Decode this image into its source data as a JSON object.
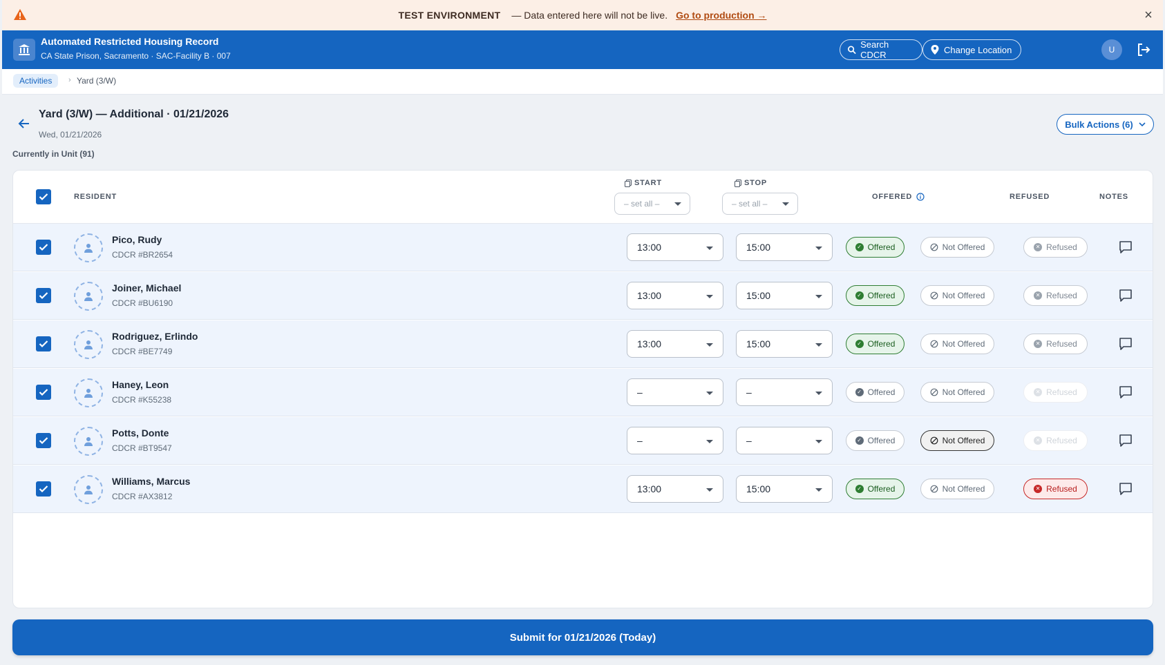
{
  "banner": {
    "environment": "TEST ENVIRONMENT",
    "message": "— Data entered here will not be live.",
    "link": "Go to production →"
  },
  "header": {
    "title": "Automated Restricted Housing Record",
    "subtitle": "CA State Prison, Sacramento · SAC-Facility B · 007",
    "search_label": "Search CDCR",
    "location_label": "Change Location",
    "user_initial": "U"
  },
  "breadcrumb": {
    "root": "Activities",
    "current": "Yard (3/W)"
  },
  "page": {
    "title": "Yard (3/W) — Additional · 01/21/2026",
    "date": "Wed, 01/21/2026",
    "unit_label": "Currently in Unit (91)",
    "bulk_label": "Bulk Actions (6)"
  },
  "table": {
    "headers": {
      "resident": "RESIDENT",
      "start": "START",
      "stop": "STOP",
      "offered": "OFFERED",
      "refused": "REFUSED",
      "notes": "NOTES"
    },
    "set_all": "– set all –",
    "labels": {
      "offered": "Offered",
      "not_offered": "Not Offered",
      "refused": "Refused"
    },
    "rows": [
      {
        "name": "Pico, Rudy",
        "id": "CDCR #BR2654",
        "start": "13:00",
        "stop": "15:00"
      },
      {
        "name": "Joiner, Michael",
        "id": "CDCR #BU6190",
        "start": "13:00",
        "stop": "15:00"
      },
      {
        "name": "Rodriguez, Erlindo",
        "id": "CDCR #BE7749",
        "start": "13:00",
        "stop": "15:00"
      },
      {
        "name": "Haney, Leon",
        "id": "CDCR #K55238",
        "start": "–",
        "stop": "–"
      },
      {
        "name": "Potts, Donte",
        "id": "CDCR #BT9547",
        "start": "–",
        "stop": "–"
      },
      {
        "name": "Williams, Marcus",
        "id": "CDCR #AX3812",
        "start": "13:00",
        "stop": "15:00"
      }
    ]
  },
  "submit_label": "Submit for 01/21/2026 (Today)",
  "colors": {
    "primary": "#1565c0",
    "offered": "#2e7d32",
    "refused": "#c62828",
    "banner_bg": "#fcefe6"
  }
}
